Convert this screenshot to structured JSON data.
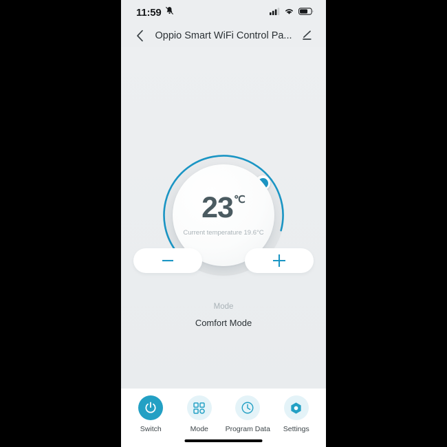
{
  "theme": {
    "accent": "#1a95c4",
    "accent_nav": "#23a0c4",
    "nav_circle_bg": "#e4f3f8",
    "page_bg": "#eceef0",
    "text_dark": "#2b3135",
    "text_muted": "#a9b2b7",
    "dial_track": "#e3e6e8"
  },
  "status_bar": {
    "time": "11:59",
    "mute_icon": "bell-muted-icon",
    "signal_icon": "cellular-signal-icon",
    "wifi_icon": "wifi-icon",
    "battery_icon": "battery-icon",
    "battery_level_pct": 65
  },
  "header": {
    "back_icon": "chevron-left-icon",
    "title": "Oppio Smart WiFi Control Pa...",
    "edit_icon": "edit-pencil-icon"
  },
  "dial": {
    "target_temperature": "23",
    "unit": "℃",
    "current_temperature_text": "Current temperature 19.6°C",
    "arc_sweep_degrees": 250,
    "arc_start_degrees": 215,
    "knob_icon": "dial-knob-handle"
  },
  "controls": {
    "decrease_label": "−",
    "decrease_name": "minus-icon",
    "increase_label": "+",
    "increase_name": "plus-icon"
  },
  "mode": {
    "label": "Mode",
    "value": "Comfort  Mode"
  },
  "nav": {
    "items": [
      {
        "label": "Switch",
        "icon": "power-icon",
        "active": true
      },
      {
        "label": "Mode",
        "icon": "grid-icon",
        "active": false
      },
      {
        "label": "Program Data",
        "icon": "clock-icon",
        "active": false
      },
      {
        "label": "Settings",
        "icon": "hex-gear-icon",
        "active": false
      }
    ]
  }
}
